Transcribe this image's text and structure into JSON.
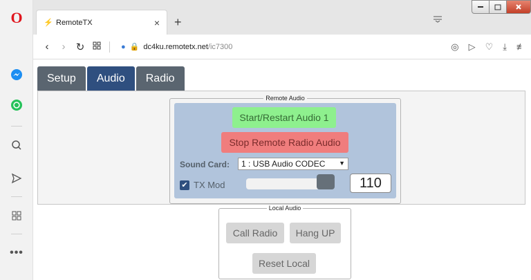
{
  "browser": {
    "tab_title": "RemoteTX",
    "tab_close": "×",
    "new_tab": "+",
    "url_host": "dc4ku.remotetx.net",
    "url_path": "/ic7300",
    "accent_color": "#e0161e"
  },
  "sidebar": {
    "items": [
      "opera-logo",
      "messenger-icon",
      "whatsapp-icon",
      "search-icon",
      "send-icon",
      "grid-icon",
      "more-icon"
    ]
  },
  "nav_tabs": {
    "setup": "Setup",
    "audio": "Audio",
    "radio": "Radio"
  },
  "remote_audio": {
    "legend": "Remote Audio",
    "start_label": "Start/Restart Audio 1",
    "stop_label": "Stop Remote Radio Audio",
    "sound_card_label": "Sound Card:",
    "sound_card_value": "1 : USB Audio CODEC",
    "tx_mod_label": "TX Mod",
    "tx_mod_checked": true,
    "tx_value": "110",
    "start_color": "#8ef08e",
    "stop_color": "#f07d7d"
  },
  "local_audio": {
    "legend": "Local Audio",
    "call_label": "Call Radio",
    "hang_label": "Hang UP",
    "reset_label": "Reset Local"
  }
}
